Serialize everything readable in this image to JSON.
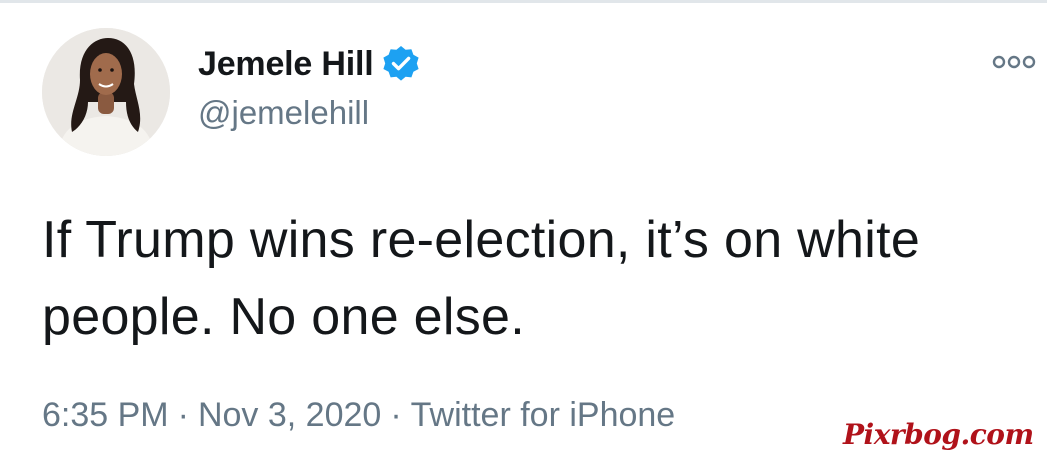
{
  "tweet": {
    "author": {
      "display_name": "Jemele Hill",
      "handle": "@jemelehill",
      "verified_icon": "verified-badge-icon",
      "avatar_icon": "profile-photo"
    },
    "more_icon": "more-options-icon",
    "text": "If Trump wins re-election, it’s on white people. No one else.",
    "meta": {
      "time": "6:35 PM",
      "separator": "·",
      "date": "Nov 3, 2020",
      "source": "Twitter for iPhone"
    }
  },
  "watermark": {
    "text": "Pixrbog.com"
  },
  "colors": {
    "primary_text": "#14171a",
    "secondary_text": "#657786",
    "verified_blue": "#1da1f2",
    "watermark_red": "#b0121a",
    "divider": "#e1e6ea"
  }
}
